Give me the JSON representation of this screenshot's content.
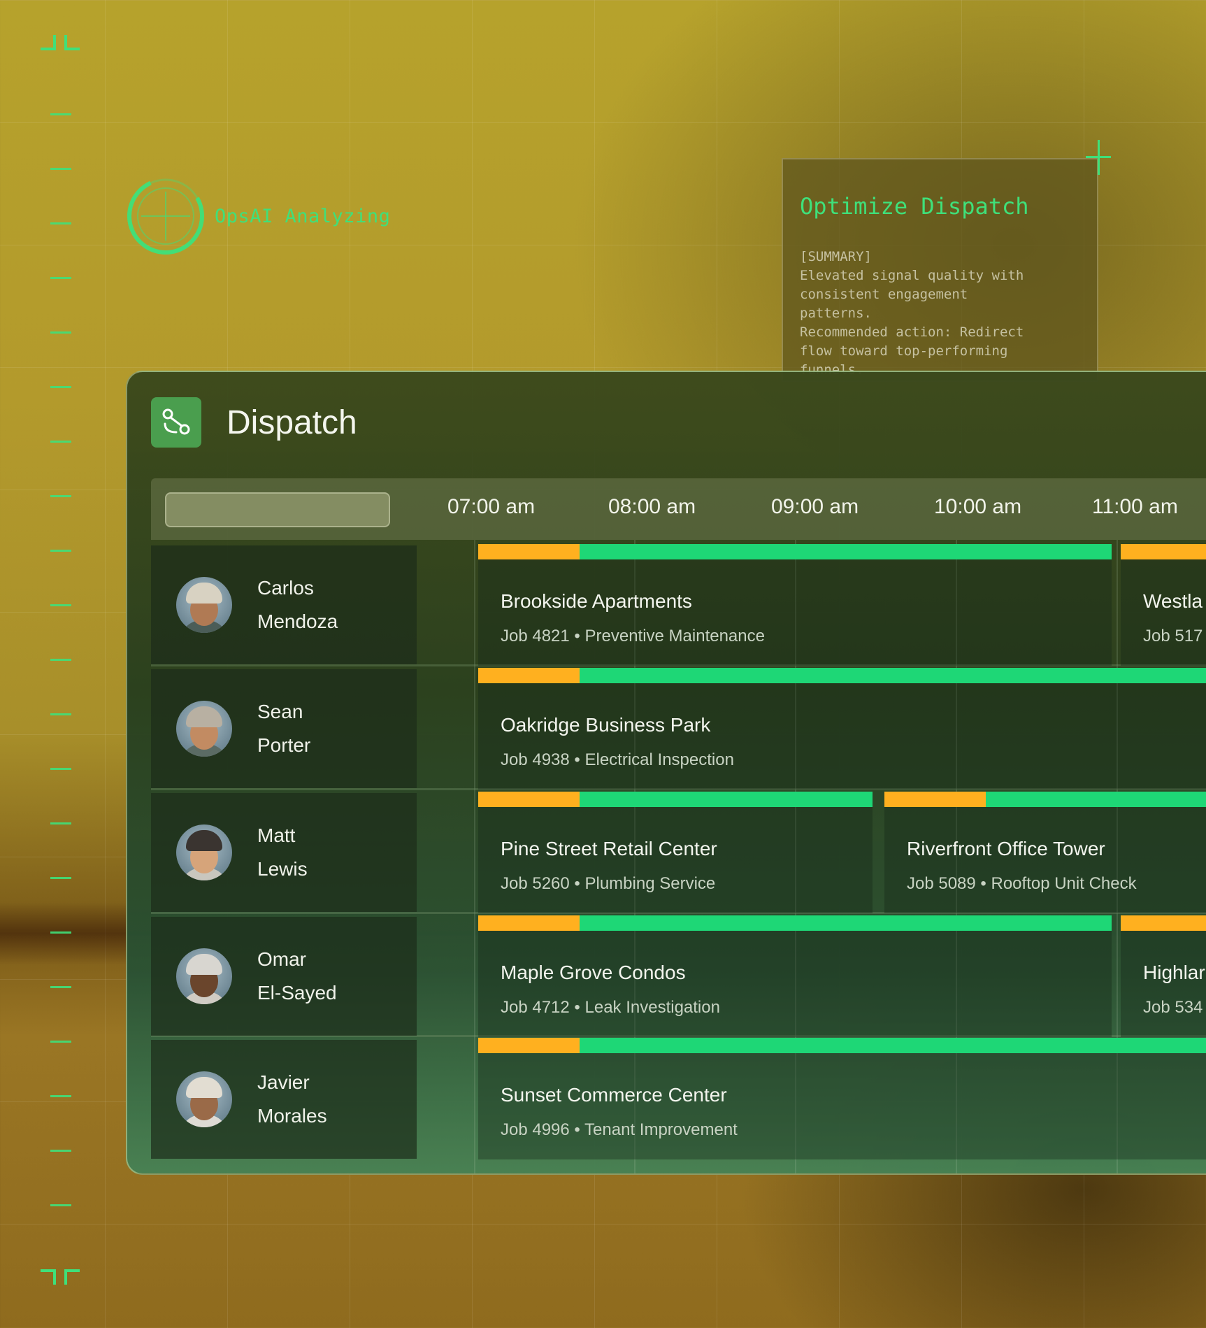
{
  "ai_status": {
    "label": "OpsAI Analyzing"
  },
  "summary": {
    "title": "Optimize Dispatch",
    "tag": "[SUMMARY]",
    "body": "Elevated signal quality with\nconsistent engagement\npatterns.\nRecommended action: Redirect\nflow toward top-performing\nfunnels."
  },
  "dispatch": {
    "title": "Dispatch",
    "search": {
      "value": "",
      "placeholder": ""
    },
    "times": [
      "07:00 am",
      "08:00 am",
      "09:00 am",
      "10:00 am",
      "11:00 am"
    ],
    "technicians": [
      {
        "first": "Carlos",
        "last": "Mendoza"
      },
      {
        "first": "Sean",
        "last": "Porter"
      },
      {
        "first": "Matt",
        "last": "Lewis"
      },
      {
        "first": "Omar",
        "last": "El-Sayed"
      },
      {
        "first": "Javier",
        "last": "Morales"
      }
    ],
    "jobs": {
      "carlos_1": {
        "title": "Brookside Apartments",
        "sub": "Job 4821 • Preventive Maintenance"
      },
      "carlos_2": {
        "title": "Westla",
        "sub": "Job 517"
      },
      "sean_1": {
        "title": "Oakridge Business Park",
        "sub": "Job 4938 • Electrical Inspection"
      },
      "matt_1": {
        "title": "Pine Street Retail Center",
        "sub": "Job 5260 • Plumbing Service"
      },
      "matt_2": {
        "title": "Riverfront Office Tower",
        "sub": "Job 5089 • Rooftop Unit Check"
      },
      "omar_1": {
        "title": "Maple Grove Condos",
        "sub": "Job 4712 • Leak Investigation"
      },
      "omar_2": {
        "title": "Highlar",
        "sub": "Job 534"
      },
      "javier_1": {
        "title": "Sunset Commerce Center",
        "sub": "Job 4996 • Tenant Improvement"
      }
    }
  },
  "colors": {
    "accent": "#3fe07a",
    "bar_pending": "#ffb01f",
    "bar_active": "#1ed776",
    "app_icon": "#4a9e4e"
  }
}
